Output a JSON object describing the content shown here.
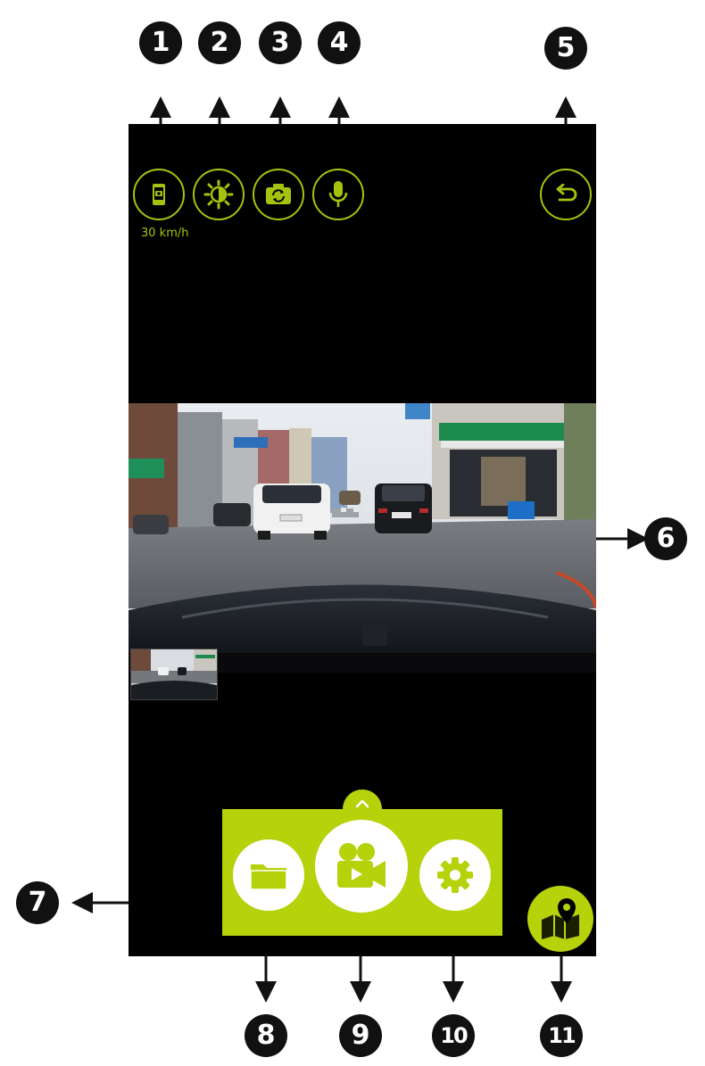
{
  "callouts": [
    "1",
    "2",
    "3",
    "4",
    "5",
    "6",
    "7",
    "8",
    "9",
    "10",
    "11"
  ],
  "status": {
    "speed": "30 km/h"
  },
  "top_bar": {
    "buttons": [
      {
        "name": "display-mode",
        "icon": "phone-camera-icon"
      },
      {
        "name": "brightness",
        "icon": "brightness-icon"
      },
      {
        "name": "switch-camera",
        "icon": "camera-switch-icon"
      },
      {
        "name": "microphone",
        "icon": "microphone-icon"
      },
      {
        "name": "back",
        "icon": "back-arrow-icon"
      }
    ]
  },
  "menu": {
    "expand_icon": "chevron-up-icon",
    "items": [
      {
        "name": "files",
        "icon": "folder-icon"
      },
      {
        "name": "record",
        "icon": "video-camera-icon"
      },
      {
        "name": "settings",
        "icon": "gear-icon"
      }
    ]
  },
  "map_button": {
    "icon": "map-pin-icon"
  },
  "colors": {
    "accent": "#b5d20b",
    "accent_outline": "#a6c20e",
    "background": "#000000",
    "callout": "#111111"
  }
}
